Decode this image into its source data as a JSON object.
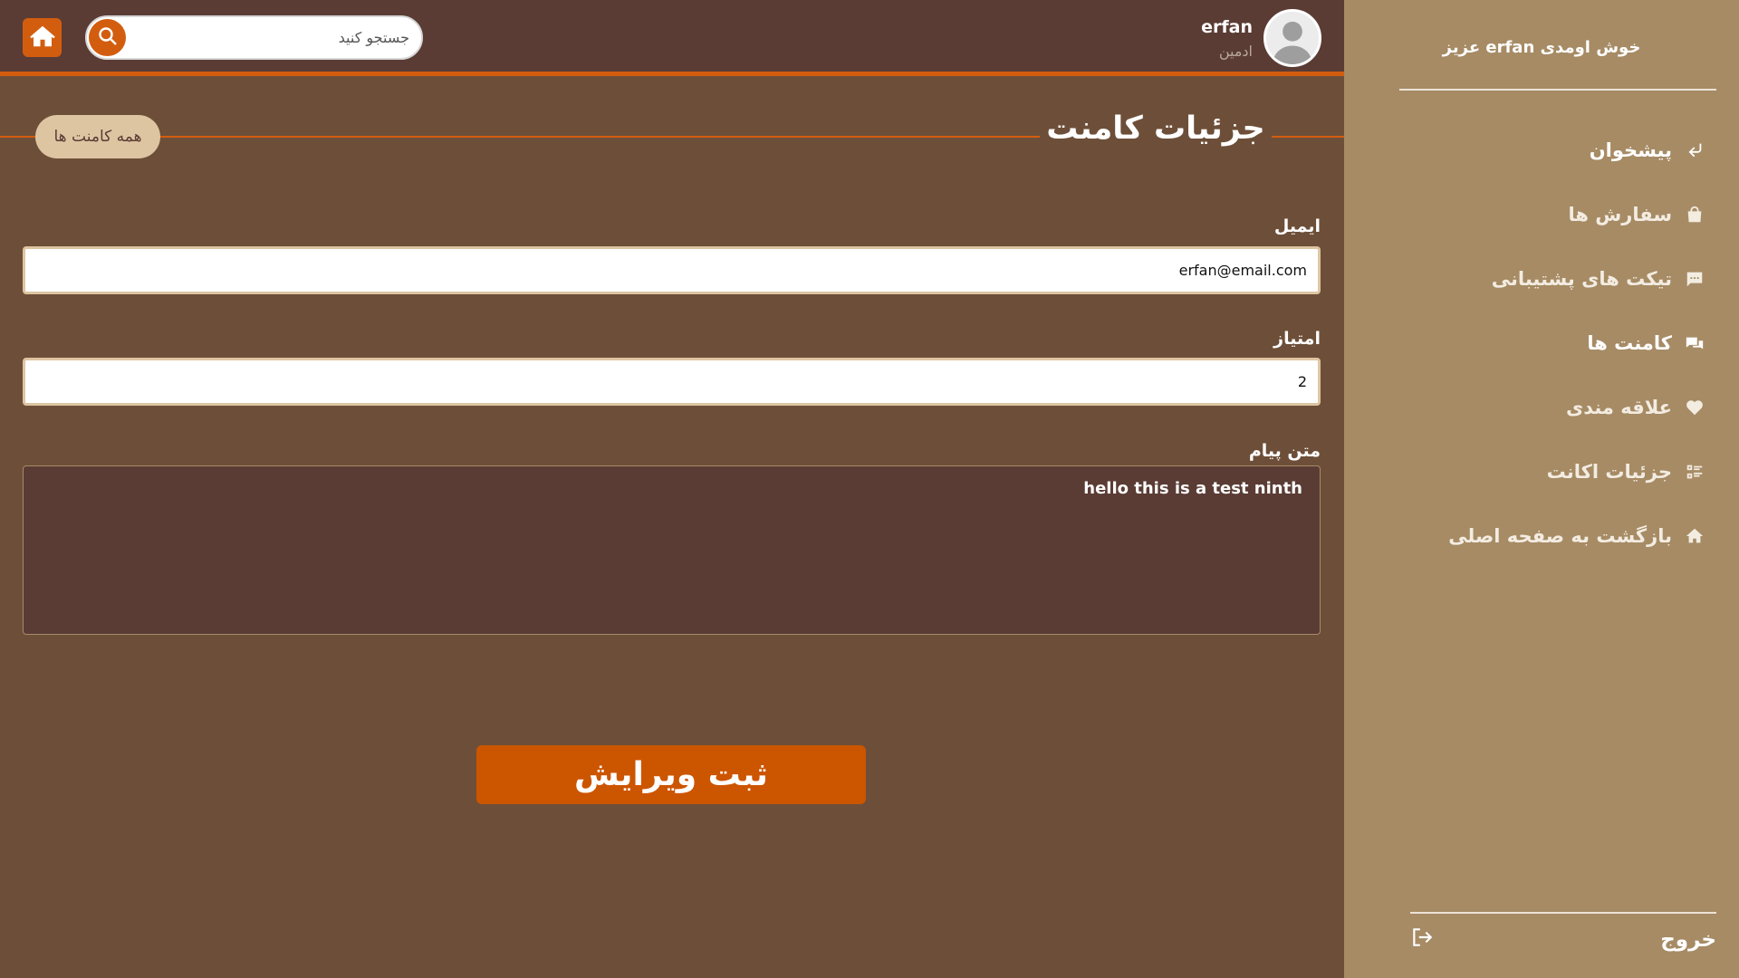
{
  "sidebar": {
    "welcome": "خوش اومدی erfan عزیز",
    "items": [
      {
        "label": "پیشخوان",
        "icon": "return-arrow-icon",
        "active": true
      },
      {
        "label": "سفارش ها",
        "icon": "shopping-bag-icon",
        "active": false
      },
      {
        "label": "تیکت های پشتیبانی",
        "icon": "message-icon",
        "active": false
      },
      {
        "label": "کامنت ها",
        "icon": "comments-icon",
        "active": true
      },
      {
        "label": "علاقه مندی",
        "icon": "heart-icon",
        "active": false
      },
      {
        "label": "جزئیات اکانت",
        "icon": "list-details-icon",
        "active": false
      },
      {
        "label": "بازگشت به صفحه اصلی",
        "icon": "home-icon",
        "active": false
      }
    ],
    "logout_label": "خروج"
  },
  "header": {
    "search_placeholder": "جستجو کنید",
    "user_name": "erfan",
    "user_role": "ادمین"
  },
  "main": {
    "title": "جزئیات کامنت",
    "all_comments_label": "همه کامنت ها",
    "email_label": "ایمیل",
    "email_value": "erfan@email.com",
    "score_label": "امتیاز",
    "score_value": "2",
    "message_label": "متن پیام",
    "message_value": "hello this is a test ninth",
    "submit_label": "ثبت ویرایش"
  },
  "colors": {
    "sidebar_bg": "#a68b65",
    "header_bg": "#5a3c35",
    "main_bg": "#6d4f39",
    "accent": "#d35d0f",
    "pill_bg": "#dec5a2"
  }
}
